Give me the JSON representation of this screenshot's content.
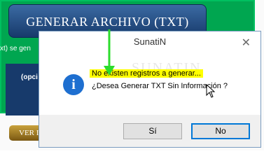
{
  "background": {
    "generate_button": "GENERAR ARCHIVO (TXT)",
    "side_text": "xt) se gen",
    "options_label": "(opci",
    "view_button": "VER I"
  },
  "dialog": {
    "title": "SunatiN",
    "watermark": "SUNATIN",
    "message_line1": "No existen registros a generar...",
    "message_line2": "¿Desea Generar TXT Sin Información ?",
    "icon": "info-icon",
    "yes_label": "Sí",
    "no_label": "No",
    "close_glyph": "✕"
  },
  "colors": {
    "highlight": "#ffff00",
    "accent": "#0078d7",
    "panel_green": "#00a650"
  }
}
